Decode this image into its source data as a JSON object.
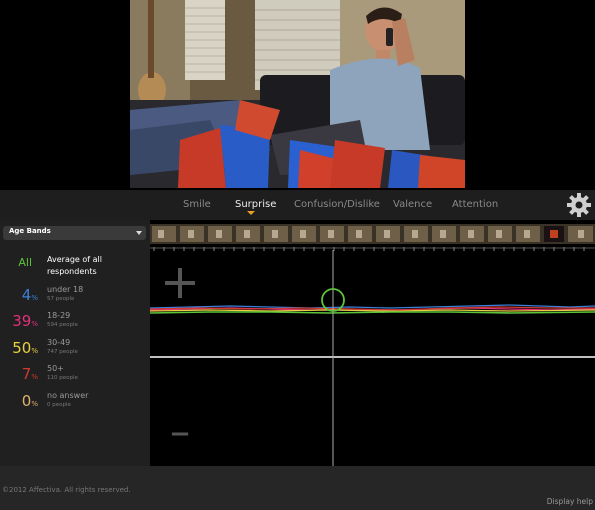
{
  "tabs": [
    {
      "label": "Smile"
    },
    {
      "label": "Surprise"
    },
    {
      "label": "Confusion/Dislike"
    },
    {
      "label": "Valence"
    },
    {
      "label": "Attention"
    }
  ],
  "active_tab": "Surprise",
  "sidebar": {
    "dropdown": {
      "selected": "Age Bands"
    },
    "all": {
      "badge": "All",
      "label": "Average of all respondents"
    },
    "groups": [
      {
        "pct": "4",
        "label": "under 18",
        "count": "57 people",
        "color": "#3b7fd9"
      },
      {
        "pct": "39",
        "label": "18-29",
        "count": "594 people",
        "color": "#e0307a"
      },
      {
        "pct": "50",
        "label": "30-49",
        "count": "747 people",
        "color": "#e8d040"
      },
      {
        "pct": "7",
        "label": "50+",
        "count": "110 people",
        "color": "#d03a30"
      },
      {
        "pct": "0",
        "label": "no answer",
        "count": "0 people",
        "color": "#e0b070"
      }
    ],
    "pct_symbol": "%"
  },
  "chart": {
    "plus": "+",
    "minus": "−",
    "playhead_pct": 41
  },
  "colors": {
    "all": "#5ec43a",
    "accent": "#e8a020"
  },
  "footer": {
    "copyright": "©2012 Affectiva. All rights reserved.",
    "help": "Display help"
  }
}
